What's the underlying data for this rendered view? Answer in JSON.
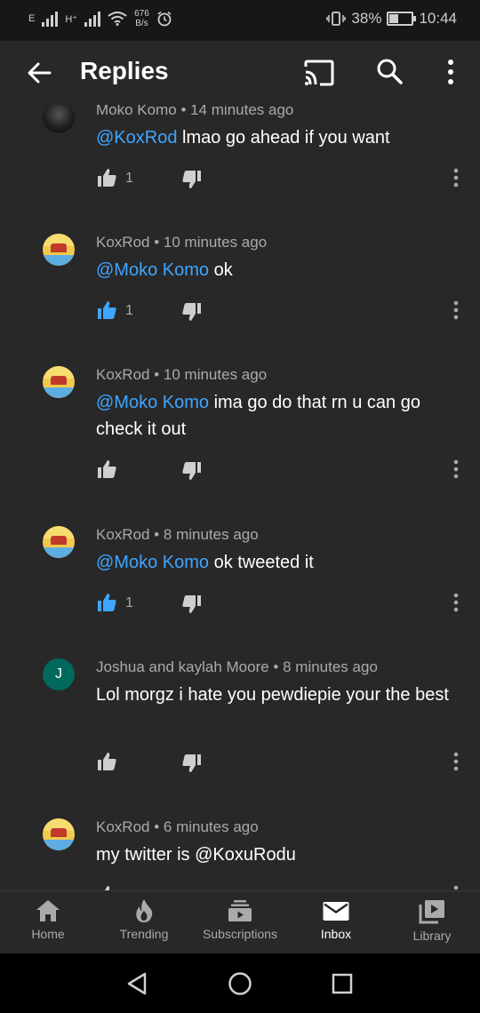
{
  "status_bar": {
    "network_left": "E",
    "network_right": "H⁺",
    "speed_value": "676",
    "speed_unit": "B/s",
    "battery": "38%",
    "battery_level": 0.38,
    "time": "10:44"
  },
  "app_bar": {
    "title": "Replies",
    "icons": [
      "back-arrow-icon",
      "cast-icon",
      "search-icon",
      "more-vertical-icon"
    ]
  },
  "comments": [
    {
      "author": "Moko Komo",
      "time": "14 minutes ago",
      "mention": "@KoxRod",
      "text": " lmao go ahead if you want",
      "likes": "1",
      "liked": false,
      "avatar": "dark"
    },
    {
      "author": "KoxRod",
      "time": "10 minutes ago",
      "mention": "@Moko Komo",
      "text": " ok",
      "likes": "1",
      "liked": true,
      "avatar": "emoji"
    },
    {
      "author": "KoxRod",
      "time": "10 minutes ago",
      "mention": "@Moko Komo",
      "text": " ima go do that rn u can go check it out",
      "likes": "",
      "liked": false,
      "avatar": "emoji"
    },
    {
      "author": "KoxRod",
      "time": "8 minutes ago",
      "mention": "@Moko Komo",
      "text": " ok tweeted it",
      "likes": "1",
      "liked": true,
      "avatar": "emoji"
    },
    {
      "author": "Joshua and kaylah Moore",
      "time": "8 minutes ago",
      "mention": "",
      "text": "Lol morgz i hate you pewdiepie your the best",
      "likes": "",
      "liked": false,
      "avatar": "J"
    },
    {
      "author": "KoxRod",
      "time": "6 minutes ago",
      "mention": "",
      "text": "my twitter is @KoxuRodu",
      "likes": "",
      "liked": false,
      "avatar": "emoji"
    }
  ],
  "separator": "•",
  "bottom_nav": [
    {
      "label": "Home",
      "icon": "home-icon",
      "active": false
    },
    {
      "label": "Trending",
      "icon": "flame-icon",
      "active": false
    },
    {
      "label": "Subscriptions",
      "icon": "subscriptions-icon",
      "active": false
    },
    {
      "label": "Inbox",
      "icon": "inbox-icon",
      "active": true
    },
    {
      "label": "Library",
      "icon": "library-icon",
      "active": false
    }
  ],
  "system_nav": [
    "back-triangle-icon",
    "home-circle-icon",
    "recents-square-icon"
  ],
  "colors": {
    "background": "#282828",
    "mention": "#3ea6ff",
    "liked": "#3ea6ff",
    "secondary_text": "#aaaaaa"
  }
}
